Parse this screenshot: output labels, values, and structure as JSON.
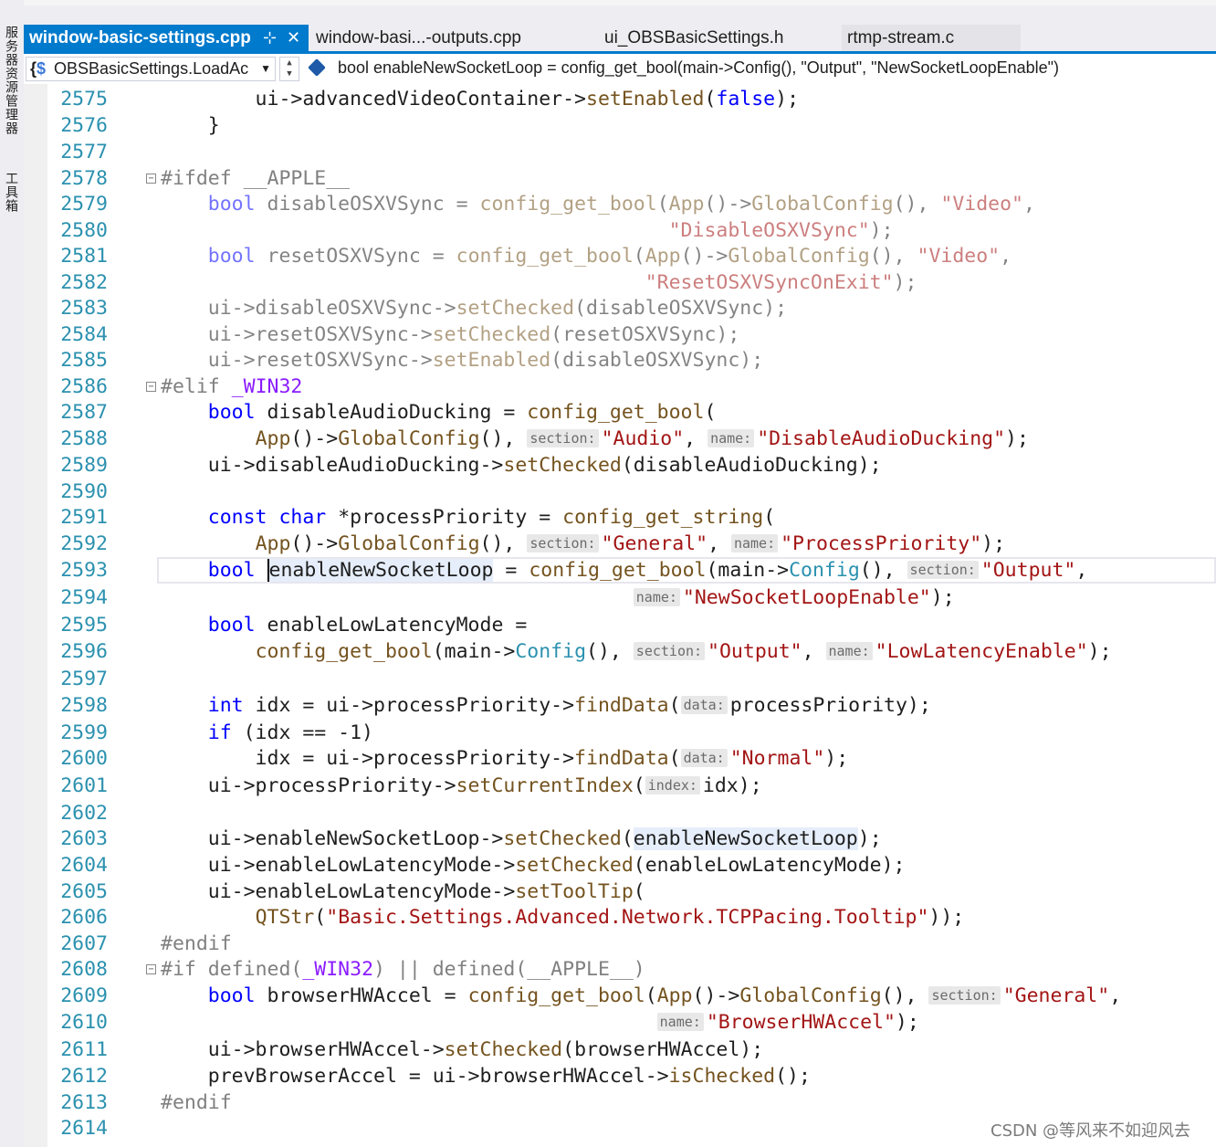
{
  "tool_window": {
    "labels": [
      "服务器资源管理器",
      "工具箱"
    ]
  },
  "tabs": [
    {
      "label": "window-basic-settings.cpp",
      "active": true,
      "pin_icon": "pin-icon",
      "close_icon": "close-icon"
    },
    {
      "label": "window-basi...-outputs.cpp"
    },
    {
      "label": "ui_OBSBasicSettings.h"
    },
    {
      "label": "rtmp-stream.c"
    }
  ],
  "navbar": {
    "scope": "OBSBasicSettings.LoadAc",
    "member": "bool enableNewSocketLoop = config_get_bool(main->Config(), \"Output\", \"NewSocketLoopEnable\")"
  },
  "editor": {
    "line_numbers": [
      "2575",
      "2576",
      "2577",
      "2578",
      "2579",
      "2580",
      "2581",
      "2582",
      "2583",
      "2584",
      "2585",
      "2586",
      "2587",
      "2588",
      "2589",
      "2590",
      "2591",
      "2592",
      "2593",
      "2594",
      "2595",
      "2596",
      "2597",
      "2598",
      "2599",
      "2600",
      "2601",
      "2602",
      "2603",
      "2604",
      "2605",
      "2606",
      "2607",
      "2608",
      "2609",
      "2610",
      "2611",
      "2612",
      "2613",
      "2614"
    ],
    "lines": [
      "        ui->advancedVideoContainer->setEnabled(false);",
      "    }",
      "",
      "#ifdef __APPLE__",
      "    bool disableOSXVSync = config_get_bool(App()->GlobalConfig(), \"Video\",",
      "                                           \"DisableOSXVSync\");",
      "    bool resetOSXVSync = config_get_bool(App()->GlobalConfig(), \"Video\",",
      "                                         \"ResetOSXVSyncOnExit\");",
      "    ui->disableOSXVSync->setChecked(disableOSXVSync);",
      "    ui->resetOSXVSync->setChecked(resetOSXVSync);",
      "    ui->resetOSXVSync->setEnabled(disableOSXVSync);",
      "#elif _WIN32",
      "    bool disableAudioDucking = config_get_bool(",
      "        App()->GlobalConfig(), section:\"Audio\", name:\"DisableAudioDucking\");",
      "    ui->disableAudioDucking->setChecked(disableAudioDucking);",
      "",
      "    const char *processPriority = config_get_string(",
      "        App()->GlobalConfig(), section:\"General\", name:\"ProcessPriority\");",
      "    bool enableNewSocketLoop = config_get_bool(main->Config(), section:\"Output\",",
      "                                        name:\"NewSocketLoopEnable\");",
      "    bool enableLowLatencyMode =",
      "        config_get_bool(main->Config(), section:\"Output\", name:\"LowLatencyEnable\");",
      "",
      "    int idx = ui->processPriority->findData(data:processPriority);",
      "    if (idx == -1)",
      "        idx = ui->processPriority->findData(data:\"Normal\");",
      "    ui->processPriority->setCurrentIndex(index:idx);",
      "",
      "    ui->enableNewSocketLoop->setChecked(enableNewSocketLoop);",
      "    ui->enableLowLatencyMode->setChecked(enableLowLatencyMode);",
      "    ui->enableLowLatencyMode->setToolTip(",
      "        QTStr(\"Basic.Settings.Advanced.Network.TCPPacing.Tooltip\"));",
      "#endif",
      "#if defined(_WIN32) || defined(__APPLE__)",
      "    bool browserHWAccel = config_get_bool(App()->GlobalConfig(), section:\"General\",",
      "                                          name:\"BrowserHWAccel\");",
      "    ui->browserHWAccel->setChecked(browserHWAccel);",
      "    prevBrowserAccel = ui->browserHWAccel->isChecked();",
      "#endif",
      ""
    ]
  },
  "watermark": "CSDN @等风来不如迎风去",
  "colors": {
    "accent": "#007acc",
    "line_number": "#2b91af",
    "keyword": "#0000ff",
    "string": "#a31515",
    "function": "#74531f",
    "type": "#2b91af",
    "preprocessor": "#808080",
    "macro": "#8a1bff"
  }
}
